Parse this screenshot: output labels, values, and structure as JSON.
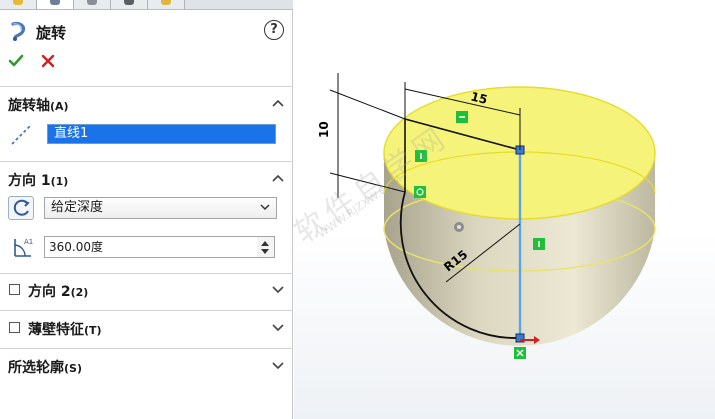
{
  "feature": {
    "title": "旋转",
    "help_label": "?"
  },
  "sections": {
    "axis": {
      "title": "旋转轴",
      "sub": "(A)",
      "value": "直线1"
    },
    "direction1": {
      "title": "方向 1",
      "sub": "(1)",
      "end_condition": "给定深度",
      "angle": "360.00度"
    },
    "direction2": {
      "title": "方向 2",
      "sub": "(2)",
      "checked": false
    },
    "thin": {
      "title": "薄壁特征",
      "sub": "(T)",
      "checked": false
    },
    "contours": {
      "title": "所选轮廓",
      "sub": "(S)"
    }
  },
  "drawing": {
    "dim_width": "15",
    "dim_height": "10",
    "dim_radius": "R15"
  },
  "watermark": {
    "text": "软件自学网",
    "url": "WWW.RJZXW.COM"
  },
  "colors": {
    "accent": "#1a73e8",
    "ok": "#2e9b2e",
    "cancel": "#d21f1f",
    "body_yellow": "#f6f37a",
    "body_shade": "#cfcab2",
    "constraint": "#1fbf3a",
    "profile": "#5aa5e6"
  },
  "icons": [
    "revolve-icon",
    "help-icon",
    "ok-check-icon",
    "cancel-x-icon",
    "axis-line-icon",
    "reverse-direction-icon",
    "angle-icon",
    "chevron-up-icon",
    "chevron-down-icon"
  ]
}
